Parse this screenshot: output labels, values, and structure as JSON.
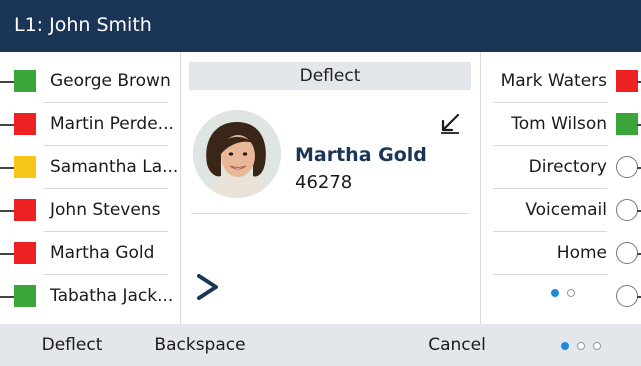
{
  "header": {
    "title": "L1: John Smith",
    "background": "#1b3557"
  },
  "left_keys": [
    {
      "label": "George Brown",
      "status": "available",
      "color": "#3aa63a"
    },
    {
      "label": "Martin Perde...",
      "status": "busy",
      "color": "#ee2222"
    },
    {
      "label": "Samantha La...",
      "status": "away",
      "color": "#f5c518"
    },
    {
      "label": "John Stevens",
      "status": "busy",
      "color": "#ee2222"
    },
    {
      "label": "Martha Gold",
      "status": "busy",
      "color": "#ee2222"
    },
    {
      "label": "Tabatha Jack...",
      "status": "available",
      "color": "#3aa63a"
    }
  ],
  "call": {
    "screen_title": "Deflect",
    "caller_name": "Martha Gold",
    "caller_number": "46278",
    "direction_icon": "incoming-call-icon",
    "more_icon": "chevron-right-icon"
  },
  "right_keys": [
    {
      "label": "Mark Waters",
      "type": "presence",
      "status": "busy",
      "color": "#ee2222"
    },
    {
      "label": "Tom Wilson",
      "type": "presence",
      "status": "available",
      "color": "#3aa63a"
    },
    {
      "label": "Directory",
      "type": "circle"
    },
    {
      "label": "Voicemail",
      "type": "circle"
    },
    {
      "label": "Home",
      "type": "circle"
    }
  ],
  "right_pager": {
    "total": 2,
    "current": 1
  },
  "softkeys": {
    "deflect": "Deflect",
    "backspace": "Backspace",
    "cancel": "Cancel",
    "pager": {
      "total": 3,
      "current": 1
    }
  },
  "colors": {
    "accent": "#1b8ad8",
    "softkey_bg": "#e3e6ea",
    "header_bg": "#1b3557"
  }
}
